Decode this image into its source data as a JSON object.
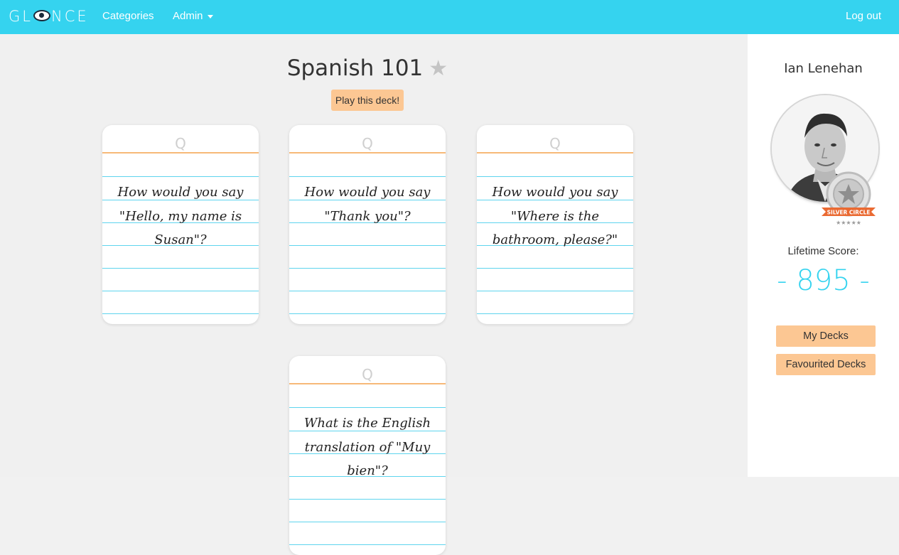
{
  "navbar": {
    "brand_left": "GL",
    "brand_right": "NCE",
    "categories_label": "Categories",
    "admin_label": "Admin",
    "logout_label": "Log out",
    "color": "#35d3ef"
  },
  "deck": {
    "title": "Spanish 101",
    "star_icon": "★",
    "play_label": "Play this deck!",
    "cards": [
      {
        "side": "Q",
        "question": "How would you say \"Hello, my name is Susan\"?"
      },
      {
        "side": "Q",
        "question": "How would you say \"Thank you\"?"
      },
      {
        "side": "Q",
        "question": "How would you say \"Where is the bathroom, please?\""
      },
      {
        "side": "Q",
        "question": "What is the English translation of \"Muy bien\"?"
      }
    ]
  },
  "sidebar": {
    "user_name": "Ian Lenehan",
    "badge_text": "SILVER CIRCLE",
    "score_label": "Lifetime Score:",
    "score_value": "- 895 -",
    "my_decks_label": "My Decks",
    "favourited_decks_label": "Favourited Decks",
    "accent_color": "#fcc793"
  }
}
